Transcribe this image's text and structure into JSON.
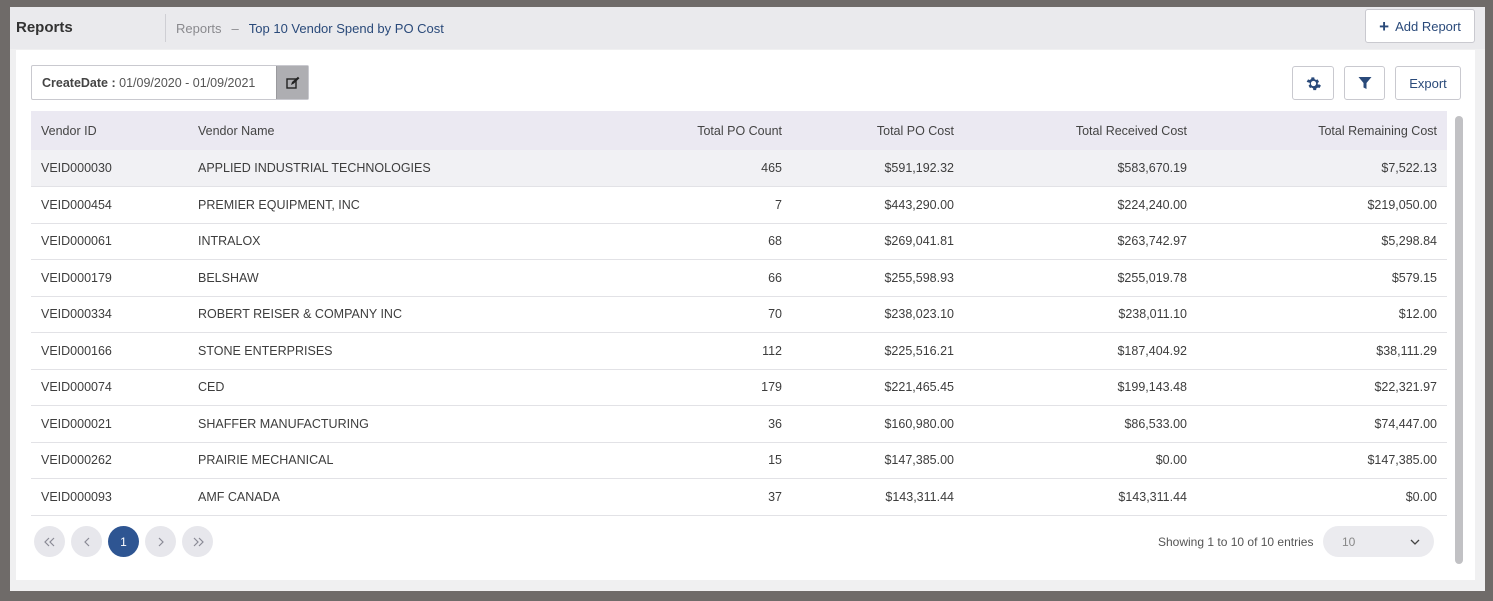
{
  "header": {
    "app_title": "Reports",
    "breadcrumb_root": "Reports",
    "breadcrumb_sep": "–",
    "breadcrumb_current": "Top 10 Vendor Spend by PO Cost",
    "add_report_label": "Add Report"
  },
  "toolbar": {
    "date_label": "CreateDate :",
    "date_value": "01/09/2020 - 01/09/2021",
    "export_label": "Export"
  },
  "table": {
    "columns": [
      "Vendor ID",
      "Vendor Name",
      "Total PO Count",
      "Total PO Cost",
      "Total Received Cost",
      "Total Remaining Cost"
    ],
    "rows": [
      [
        "VEID000030",
        "APPLIED INDUSTRIAL TECHNOLOGIES",
        "465",
        "$591,192.32",
        "$583,670.19",
        "$7,522.13"
      ],
      [
        "VEID000454",
        "PREMIER EQUIPMENT, INC",
        "7",
        "$443,290.00",
        "$224,240.00",
        "$219,050.00"
      ],
      [
        "VEID000061",
        "INTRALOX",
        "68",
        "$269,041.81",
        "$263,742.97",
        "$5,298.84"
      ],
      [
        "VEID000179",
        "BELSHAW",
        "66",
        "$255,598.93",
        "$255,019.78",
        "$579.15"
      ],
      [
        "VEID000334",
        "ROBERT REISER & COMPANY INC",
        "70",
        "$238,023.10",
        "$238,011.10",
        "$12.00"
      ],
      [
        "VEID000166",
        "STONE ENTERPRISES",
        "112",
        "$225,516.21",
        "$187,404.92",
        "$38,111.29"
      ],
      [
        "VEID000074",
        "CED",
        "179",
        "$221,465.45",
        "$199,143.48",
        "$22,321.97"
      ],
      [
        "VEID000021",
        "SHAFFER MANUFACTURING",
        "36",
        "$160,980.00",
        "$86,533.00",
        "$74,447.00"
      ],
      [
        "VEID000262",
        "PRAIRIE MECHANICAL",
        "15",
        "$147,385.00",
        "$0.00",
        "$147,385.00"
      ],
      [
        "VEID000093",
        "AMF CANADA",
        "37",
        "$143,311.44",
        "$143,311.44",
        "$0.00"
      ]
    ]
  },
  "pagination": {
    "current_page": "1",
    "entries_text": "Showing 1 to 10 of 10 entries",
    "page_size": "10"
  },
  "colors": {
    "accent": "#2e5592",
    "header_bg": "#ebe9f2"
  }
}
